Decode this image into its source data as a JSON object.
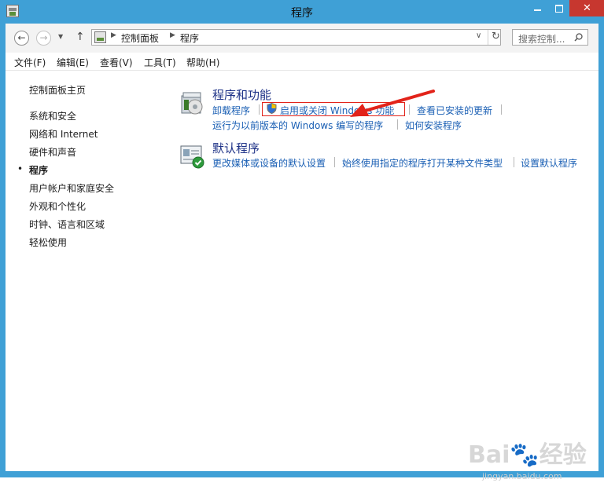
{
  "window": {
    "title": "程序",
    "controls": {
      "minimize": "—",
      "maximize": "☐",
      "close": "✕"
    }
  },
  "navbar": {
    "breadcrumb": [
      "控制面板",
      "程序"
    ],
    "search_placeholder": "搜索控制...",
    "icons": [
      "back-arrow-icon",
      "forward-arrow-icon",
      "recent-dropdown-icon",
      "up-arrow-icon",
      "control-panel-icon",
      "dropdown-icon",
      "refresh-icon",
      "search-icon"
    ]
  },
  "menu": [
    "文件(F)",
    "编辑(E)",
    "查看(V)",
    "工具(T)",
    "帮助(H)"
  ],
  "left_pane": {
    "home": "控制面板主页",
    "items": [
      "系统和安全",
      "网络和 Internet",
      "硬件和声音",
      "程序",
      "用户帐户和家庭安全",
      "外观和个性化",
      "时钟、语言和区域",
      "轻松使用"
    ],
    "current": "程序"
  },
  "categories": [
    {
      "title": "程序和功能",
      "icon": "programs-features-icon",
      "tasks": [
        "卸载程序",
        "启用或关闭 Windows 功能",
        "查看已安装的更新",
        "运行为以前版本的 Windows 编写的程序",
        "如何安装程序"
      ]
    },
    {
      "title": "默认程序",
      "icon": "default-programs-icon",
      "tasks": [
        "更改媒体或设备的默认设置",
        "始终使用指定的程序打开某种文件类型",
        "设置默认程序"
      ]
    }
  ],
  "annotation": {
    "highlight_color": "#e2231a"
  },
  "watermark": {
    "logo": "Baidu经验",
    "url": "jingyan.baidu.com"
  },
  "colors": {
    "titlebar": "#3fa0d6",
    "link": "#1a5fb4",
    "category_title": "#1e3287",
    "close_button": "#c7372f"
  }
}
